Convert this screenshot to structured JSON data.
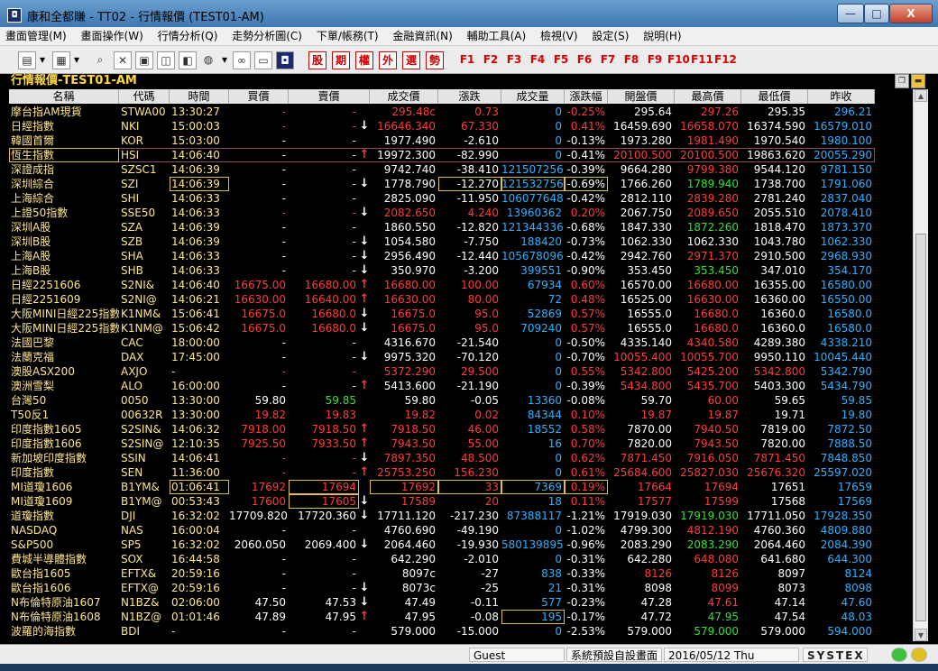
{
  "window": {
    "title": "康和全都賺 - TT02 - 行情報價 (TEST01-AM)",
    "min_label": "—",
    "max_label": "□",
    "close_label": "X"
  },
  "menu": [
    "畫面管理(M)",
    "畫面操作(W)",
    "行情分析(Q)",
    "走勢分析圖(C)",
    "下單/帳務(T)",
    "金融資訊(N)",
    "輔助工具(A)",
    "檢視(V)",
    "設定(S)",
    "說明(H)"
  ],
  "toolbar": {
    "quick_buttons": [
      "股",
      "期",
      "權",
      "外",
      "選",
      "勢"
    ],
    "fkeys": [
      "F1",
      "F2",
      "F3",
      "F4",
      "F5",
      "F6",
      "F7",
      "F8",
      "F9",
      "F10",
      "F11",
      "F12"
    ]
  },
  "panel": {
    "title": "行情報價-TEST01-AM"
  },
  "table": {
    "headers": [
      "名稱",
      "代碼",
      "時間",
      "買價",
      "賣價",
      "成交價",
      "漲跌",
      "成交量",
      "漲跌幅",
      "開盤價",
      "最高價",
      "最低價",
      "昨收"
    ],
    "rows": [
      [
        "摩台指AM現貨",
        "STWA00",
        "13:30:27",
        "-",
        "-",
        "295.48c",
        "0.73",
        "0",
        "-0.25%",
        "295.64",
        "297.26",
        "295.35",
        "296.21"
      ],
      [
        "日經指數",
        "NKI",
        "15:00:03",
        "-",
        "-",
        "16646.340",
        "67.330",
        "0",
        "0.41%",
        "16459.690",
        "16658.070",
        "16374.590",
        "16579.010"
      ],
      [
        "韓國首爾",
        "KOR",
        "15:03:00",
        "-",
        "-",
        "1977.490",
        "-2.610",
        "0",
        "-0.13%",
        "1973.280",
        "1981.490",
        "1970.540",
        "1980.100"
      ],
      [
        "恆生指數",
        "HSI",
        "14:06:40",
        "-",
        "-",
        "19972.300",
        "-82.990",
        "0",
        "-0.41%",
        "20100.500",
        "20100.500",
        "19863.620",
        "20055.290"
      ],
      [
        "深證成指",
        "SZSC1",
        "14:06:39",
        "-",
        "-",
        "9742.740",
        "-38.410",
        "121507256",
        "-0.39%",
        "9664.280",
        "9799.380",
        "9544.120",
        "9781.150"
      ],
      [
        "深圳綜合",
        "SZI",
        "14:06:39",
        "-",
        "-",
        "1778.790",
        "-12.270",
        "121532756",
        "-0.69%",
        "1766.260",
        "1789.940",
        "1738.700",
        "1791.060"
      ],
      [
        "上海綜合",
        "SHI",
        "14:06:33",
        "-",
        "-",
        "2825.090",
        "-11.950",
        "106077648",
        "-0.42%",
        "2812.110",
        "2839.280",
        "2781.240",
        "2837.040"
      ],
      [
        "上證50指數",
        "SSE50",
        "14:06:33",
        "-",
        "-",
        "2082.650",
        "4.240",
        "13960362",
        "0.20%",
        "2067.750",
        "2089.650",
        "2055.510",
        "2078.410"
      ],
      [
        "深圳A股",
        "SZA",
        "14:06:39",
        "-",
        "-",
        "1860.550",
        "-12.820",
        "121344336",
        "-0.68%",
        "1847.330",
        "1872.260",
        "1818.470",
        "1873.370"
      ],
      [
        "深圳B股",
        "SZB",
        "14:06:39",
        "-",
        "-",
        "1054.580",
        "-7.750",
        "188420",
        "-0.73%",
        "1062.330",
        "1062.330",
        "1043.780",
        "1062.330"
      ],
      [
        "上海A股",
        "SHA",
        "14:06:33",
        "-",
        "-",
        "2956.490",
        "-12.440",
        "105678096",
        "-0.42%",
        "2942.760",
        "2971.370",
        "2910.500",
        "2968.930"
      ],
      [
        "上海B股",
        "SHB",
        "14:06:33",
        "-",
        "-",
        "350.970",
        "-3.200",
        "399551",
        "-0.90%",
        "353.450",
        "353.450",
        "347.010",
        "354.170"
      ],
      [
        "日經2251606",
        "S2NI&",
        "14:06:40",
        "16675.00",
        "16680.00",
        "16680.00",
        "100.00",
        "67934",
        "0.60%",
        "16570.00",
        "16680.00",
        "16355.00",
        "16580.00"
      ],
      [
        "日經2251609",
        "S2NI@",
        "14:06:21",
        "16630.00",
        "16640.00",
        "16630.00",
        "80.00",
        "72",
        "0.48%",
        "16525.00",
        "16630.00",
        "16360.00",
        "16550.00"
      ],
      [
        "大阪MINI日經225指數",
        "K1NM&",
        "15:06:41",
        "16675.0",
        "16680.0",
        "16675.0",
        "95.0",
        "52869",
        "0.57%",
        "16555.0",
        "16680.0",
        "16360.0",
        "16580.0"
      ],
      [
        "大阪MINI日經225指數",
        "K1NM@",
        "15:06:42",
        "16675.0",
        "16680.0",
        "16675.0",
        "95.0",
        "709240",
        "0.57%",
        "16555.0",
        "16680.0",
        "16360.0",
        "16580.0"
      ],
      [
        "法國巴黎",
        "CAC",
        "18:00:00",
        "-",
        "-",
        "4316.670",
        "-21.540",
        "0",
        "-0.50%",
        "4335.140",
        "4340.580",
        "4289.380",
        "4338.210"
      ],
      [
        "法蘭克福",
        "DAX",
        "17:45:00",
        "-",
        "-",
        "9975.320",
        "-70.120",
        "0",
        "-0.70%",
        "10055.400",
        "10055.700",
        "9950.110",
        "10045.440"
      ],
      [
        "澳股ASX200",
        "AXJO",
        "-",
        "-",
        "-",
        "5372.290",
        "29.500",
        "0",
        "0.55%",
        "5342.800",
        "5425.200",
        "5342.800",
        "5342.790"
      ],
      [
        "澳洲雪梨",
        "ALO",
        "16:00:00",
        "-",
        "-",
        "5413.600",
        "-21.190",
        "0",
        "-0.39%",
        "5434.800",
        "5435.700",
        "5403.300",
        "5434.790"
      ],
      [
        "台灣50",
        "0050",
        "13:30:00",
        "59.80",
        "59.85",
        "59.80",
        "-0.05",
        "13360",
        "-0.08%",
        "59.70",
        "60.00",
        "59.65",
        "59.85"
      ],
      [
        "T50反1",
        "00632R",
        "13:30:00",
        "19.82",
        "19.83",
        "19.82",
        "0.02",
        "84344",
        "0.10%",
        "19.87",
        "19.87",
        "19.71",
        "19.80"
      ],
      [
        "印度指數1605",
        "S2SIN&",
        "14:06:32",
        "7918.00",
        "7918.50",
        "7918.50",
        "46.00",
        "18552",
        "0.58%",
        "7870.00",
        "7940.50",
        "7819.00",
        "7872.50"
      ],
      [
        "印度指數1606",
        "S2SIN@",
        "12:10:35",
        "7925.50",
        "7933.50",
        "7943.50",
        "55.00",
        "16",
        "0.70%",
        "7820.00",
        "7943.50",
        "7820.00",
        "7888.50"
      ],
      [
        "新加坡印度指數",
        "SSIN",
        "14:06:41",
        "-",
        "-",
        "7897.350",
        "48.500",
        "0",
        "0.62%",
        "7871.450",
        "7916.050",
        "7871.450",
        "7848.850"
      ],
      [
        "印度指數",
        "SEN",
        "11:36:00",
        "-",
        "-",
        "25753.250",
        "156.230",
        "0",
        "0.61%",
        "25684.600",
        "25827.030",
        "25676.320",
        "25597.020"
      ],
      [
        "MI道瓊1606",
        "B1YM&",
        "01:06:41",
        "17692",
        "17694",
        "17692",
        "33",
        "7369",
        "0.19%",
        "17664",
        "17694",
        "17651",
        "17659"
      ],
      [
        "MI道瓊1609",
        "B1YM@",
        "00:53:43",
        "17600",
        "17605",
        "17589",
        "20",
        "18",
        "0.11%",
        "17577",
        "17599",
        "17568",
        "17569"
      ],
      [
        "道瓊指數",
        "DJI",
        "16:32:02",
        "17709.820",
        "17720.360",
        "17711.120",
        "-217.230",
        "87388117",
        "-1.21%",
        "17919.030",
        "17919.030",
        "17711.050",
        "17928.350"
      ],
      [
        "NASDAQ",
        "NAS",
        "16:00:04",
        "-",
        "-",
        "4760.690",
        "-49.190",
        "0",
        "-1.02%",
        "4799.300",
        "4812.190",
        "4760.360",
        "4809.880"
      ],
      [
        "S&P500",
        "SP5",
        "16:32:02",
        "2060.050",
        "2069.400",
        "2064.460",
        "-19.930",
        "580139895",
        "-0.96%",
        "2083.290",
        "2083.290",
        "2064.460",
        "2084.390"
      ],
      [
        "費城半導體指數",
        "SOX",
        "16:44:58",
        "-",
        "-",
        "642.290",
        "-2.010",
        "0",
        "-0.31%",
        "642.280",
        "648.080",
        "641.680",
        "644.300"
      ],
      [
        "歐台指1605",
        "EFTX&",
        "20:59:16",
        "-",
        "-",
        "8097c",
        "-27",
        "838",
        "-0.33%",
        "8126",
        "8126",
        "8097",
        "8124"
      ],
      [
        "歐台指1606",
        "EFTX@",
        "20:59:16",
        "-",
        "-",
        "8073c",
        "-25",
        "21",
        "-0.31%",
        "8098",
        "8099",
        "8073",
        "8098"
      ],
      [
        "N布倫特原油1607",
        "N1BZ&",
        "02:06:00",
        "47.50",
        "47.53",
        "47.49",
        "-0.11",
        "577",
        "-0.23%",
        "47.28",
        "47.61",
        "47.14",
        "47.60"
      ],
      [
        "N布倫特原油1608",
        "N1BZ@",
        "01:01:46",
        "47.89",
        "47.95",
        "47.95",
        "-0.08",
        "195",
        "-0.17%",
        "47.72",
        "47.95",
        "47.54",
        "48.03"
      ],
      [
        "波羅的海指數",
        "BDI",
        "-",
        "-",
        "-",
        "579.000",
        "-15.000",
        "0",
        "-2.53%",
        "579.000",
        "579.000",
        "579.000",
        "594.000"
      ]
    ],
    "arrows": [
      "",
      "↓",
      "",
      "↑",
      "",
      "↓",
      "",
      "↓",
      "",
      "↓",
      "↓",
      "↓",
      "↑",
      "↑",
      "↓",
      "↓",
      "",
      "↓",
      "",
      "↑",
      "",
      "",
      "↑",
      "↑",
      "↓",
      "↑",
      "",
      "↓",
      "↓",
      "",
      "↓",
      "",
      "",
      "↓",
      "↓",
      "↑",
      ""
    ]
  },
  "status": {
    "user": "Guest",
    "layout": "系統預設自設畫面",
    "datetime": "2016/05/12 Thu 14:06:54",
    "brand": "SYSTEX"
  }
}
